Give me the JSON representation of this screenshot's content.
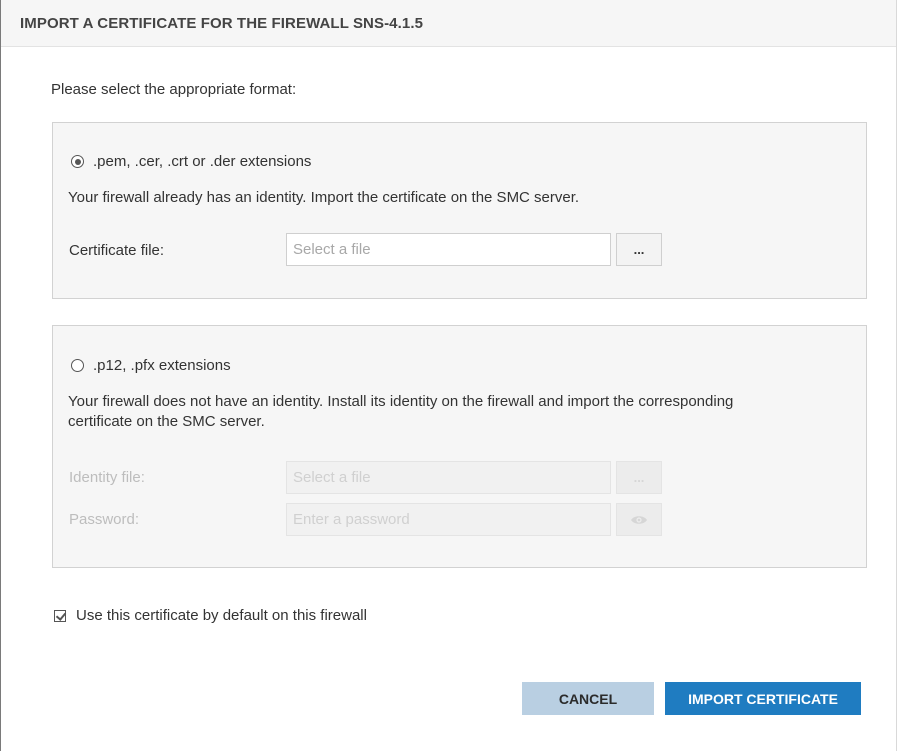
{
  "dialog": {
    "title": "IMPORT A CERTIFICATE FOR THE FIREWALL SNS-4.1.5",
    "prompt": "Please select the appropriate format:"
  },
  "pem_option": {
    "label": ".pem, .cer, .crt or .der extensions",
    "selected": true,
    "description": "Your firewall already has an identity. Import the certificate on the SMC server.",
    "certificate_file_label": "Certificate file:",
    "certificate_file_placeholder": "Select a file",
    "certificate_file_value": "",
    "browse_label": "..."
  },
  "p12_option": {
    "label": ".p12, .pfx extensions",
    "selected": false,
    "description": "Your firewall does not have an identity. Install its identity on the firewall and import the corresponding certificate on the SMC server.",
    "identity_file_label": "Identity file:",
    "identity_file_placeholder": "Select a file",
    "browse_label": "...",
    "password_label": "Password:",
    "password_placeholder": "Enter a password",
    "show_password_icon": "eye-icon"
  },
  "default_checkbox": {
    "label": "Use this certificate by default on this firewall",
    "checked": true
  },
  "buttons": {
    "cancel": "CANCEL",
    "import": "IMPORT CERTIFICATE"
  },
  "colors": {
    "primary": "#1f7cc1",
    "cancel_bg": "#b9cfe2",
    "panel_bg": "#f6f6f6"
  }
}
